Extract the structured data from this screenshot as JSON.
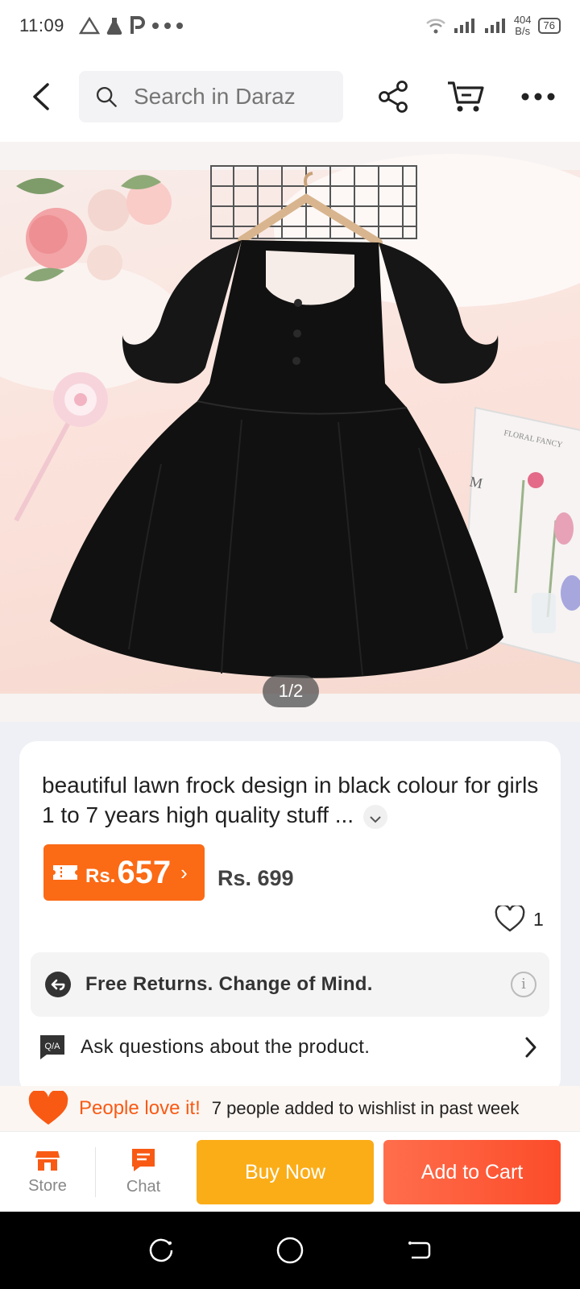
{
  "status_bar": {
    "time": "11:09",
    "left_icons": [
      "warning-triangle-icon",
      "flask-icon",
      "p-icon",
      "more-dots-icon"
    ],
    "net_speed_value": "404",
    "net_speed_unit": "B/s",
    "battery": "76"
  },
  "header": {
    "search_placeholder": "Search in Daraz"
  },
  "gallery": {
    "counter": "1/2",
    "packaging_text": "FLORAL FANCY",
    "packaging_letter": "M"
  },
  "product": {
    "title": "beautiful lawn frock design in black colour for girls 1 to 7 years  high quality stuff ...",
    "price_currency": "Rs.",
    "price_value": "657",
    "original_price": "Rs. 699",
    "wishlist_count": "1",
    "returns_text": "Free Returns. Change of Mind.",
    "qa_badge": "Q/A",
    "qa_text": "Ask questions about the product."
  },
  "popularity": {
    "highlight": "People love it!",
    "text": "7 people added to wishlist in past week"
  },
  "bottom_bar": {
    "store_label": "Store",
    "chat_label": "Chat",
    "buy_now": "Buy Now",
    "add_to_cart": "Add to Cart"
  },
  "colors": {
    "brand_orange": "#fb6a15",
    "buy_now": "#fbad18",
    "add_to_cart": "#fc4c2a"
  }
}
